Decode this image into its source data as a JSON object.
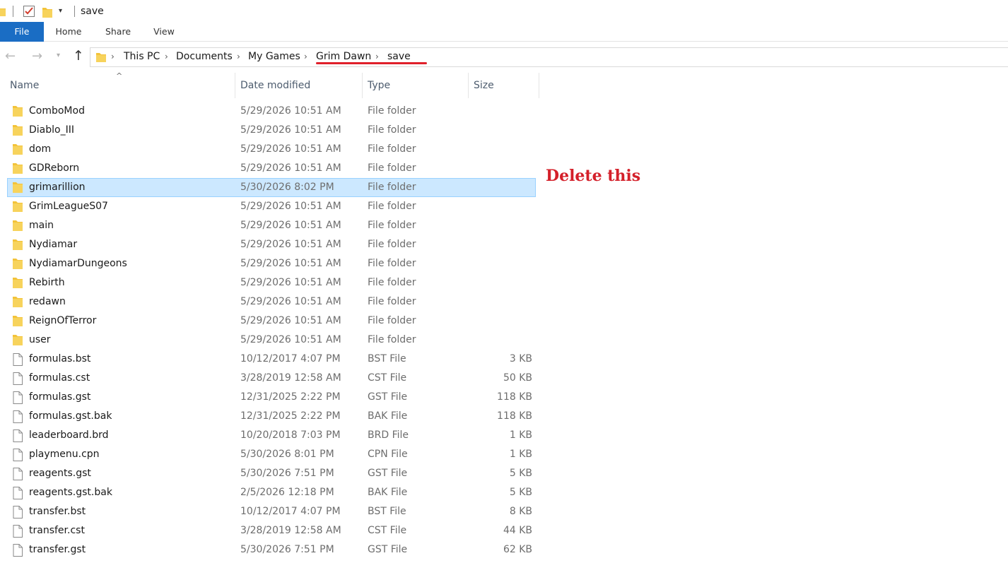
{
  "window": {
    "title": "save"
  },
  "ribbon": {
    "tabs": [
      "File",
      "Home",
      "Share",
      "View"
    ]
  },
  "address": {
    "crumbs": [
      "This PC",
      "Documents",
      "My Games",
      "Grim Dawn",
      "save"
    ]
  },
  "columns": {
    "name": "Name",
    "date": "Date modified",
    "type": "Type",
    "size": "Size"
  },
  "files": [
    {
      "name": "ComboMod",
      "date": "5/29/2026 10:51 AM",
      "type": "File folder",
      "size": "",
      "kind": "folder"
    },
    {
      "name": "Diablo_III",
      "date": "5/29/2026 10:51 AM",
      "type": "File folder",
      "size": "",
      "kind": "folder"
    },
    {
      "name": "dom",
      "date": "5/29/2026 10:51 AM",
      "type": "File folder",
      "size": "",
      "kind": "folder"
    },
    {
      "name": "GDReborn",
      "date": "5/29/2026 10:51 AM",
      "type": "File folder",
      "size": "",
      "kind": "folder"
    },
    {
      "name": "grimarillion",
      "date": "5/30/2026 8:02 PM",
      "type": "File folder",
      "size": "",
      "kind": "folder",
      "selected": true
    },
    {
      "name": "GrimLeagueS07",
      "date": "5/29/2026 10:51 AM",
      "type": "File folder",
      "size": "",
      "kind": "folder"
    },
    {
      "name": "main",
      "date": "5/29/2026 10:51 AM",
      "type": "File folder",
      "size": "",
      "kind": "folder"
    },
    {
      "name": "Nydiamar",
      "date": "5/29/2026 10:51 AM",
      "type": "File folder",
      "size": "",
      "kind": "folder"
    },
    {
      "name": "NydiamarDungeons",
      "date": "5/29/2026 10:51 AM",
      "type": "File folder",
      "size": "",
      "kind": "folder"
    },
    {
      "name": "Rebirth",
      "date": "5/29/2026 10:51 AM",
      "type": "File folder",
      "size": "",
      "kind": "folder"
    },
    {
      "name": "redawn",
      "date": "5/29/2026 10:51 AM",
      "type": "File folder",
      "size": "",
      "kind": "folder"
    },
    {
      "name": "ReignOfTerror",
      "date": "5/29/2026 10:51 AM",
      "type": "File folder",
      "size": "",
      "kind": "folder"
    },
    {
      "name": "user",
      "date": "5/29/2026 10:51 AM",
      "type": "File folder",
      "size": "",
      "kind": "folder"
    },
    {
      "name": "formulas.bst",
      "date": "10/12/2017 4:07 PM",
      "type": "BST File",
      "size": "3 KB",
      "kind": "file"
    },
    {
      "name": "formulas.cst",
      "date": "3/28/2019 12:58 AM",
      "type": "CST File",
      "size": "50 KB",
      "kind": "file"
    },
    {
      "name": "formulas.gst",
      "date": "12/31/2025 2:22 PM",
      "type": "GST File",
      "size": "118 KB",
      "kind": "file"
    },
    {
      "name": "formulas.gst.bak",
      "date": "12/31/2025 2:22 PM",
      "type": "BAK File",
      "size": "118 KB",
      "kind": "file"
    },
    {
      "name": "leaderboard.brd",
      "date": "10/20/2018 7:03 PM",
      "type": "BRD File",
      "size": "1 KB",
      "kind": "file"
    },
    {
      "name": "playmenu.cpn",
      "date": "5/30/2026 8:01 PM",
      "type": "CPN File",
      "size": "1 KB",
      "kind": "file"
    },
    {
      "name": "reagents.gst",
      "date": "5/30/2026 7:51 PM",
      "type": "GST File",
      "size": "5 KB",
      "kind": "file"
    },
    {
      "name": "reagents.gst.bak",
      "date": "2/5/2026 12:18 PM",
      "type": "BAK File",
      "size": "5 KB",
      "kind": "file"
    },
    {
      "name": "transfer.bst",
      "date": "10/12/2017 4:07 PM",
      "type": "BST File",
      "size": "8 KB",
      "kind": "file"
    },
    {
      "name": "transfer.cst",
      "date": "3/28/2019 12:58 AM",
      "type": "CST File",
      "size": "44 KB",
      "kind": "file"
    },
    {
      "name": "transfer.gst",
      "date": "5/30/2026 7:51 PM",
      "type": "GST File",
      "size": "62 KB",
      "kind": "file"
    }
  ],
  "annotation": {
    "text": "Delete this",
    "color": "#d4202a"
  },
  "colors": {
    "accent": "#1a6dc4",
    "selection": "#cce8ff",
    "folder": "#f3c33a"
  }
}
